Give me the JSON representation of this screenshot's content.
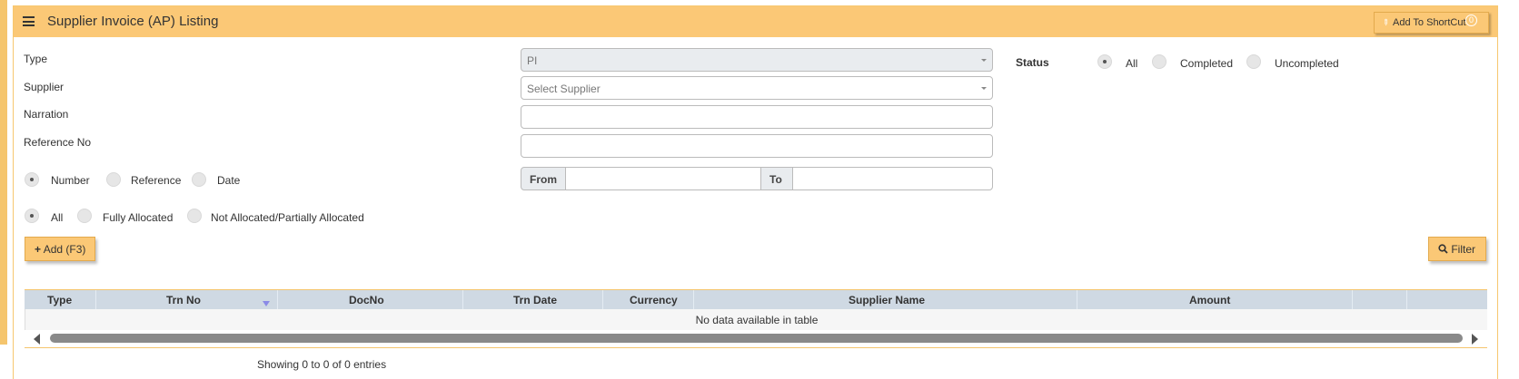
{
  "header": {
    "title": "Supplier Invoice (AP) Listing",
    "shortcut_label": "Add To ShortCut",
    "shortcut_count": "0"
  },
  "form": {
    "type_label": "Type",
    "type_value": "PI",
    "supplier_label": "Supplier",
    "supplier_placeholder": "Select Supplier",
    "narration_label": "Narration",
    "reference_label": "Reference No",
    "search_by": [
      "Number",
      "Reference",
      "Date"
    ],
    "from_label": "From",
    "to_label": "To",
    "allocation": [
      "All",
      "Fully Allocated",
      "Not Allocated/Partially Allocated"
    ]
  },
  "status": {
    "label": "Status",
    "options": [
      "All",
      "Completed",
      "Uncompleted"
    ]
  },
  "buttons": {
    "add": "Add (F3)",
    "filter": "Filter"
  },
  "table": {
    "columns": [
      "Type",
      "Trn No",
      "DocNo",
      "Trn Date",
      "Currency",
      "Supplier Name",
      "Amount"
    ],
    "empty_message": "No data available in table",
    "info": "Showing 0 to 0 of 0 entries"
  }
}
